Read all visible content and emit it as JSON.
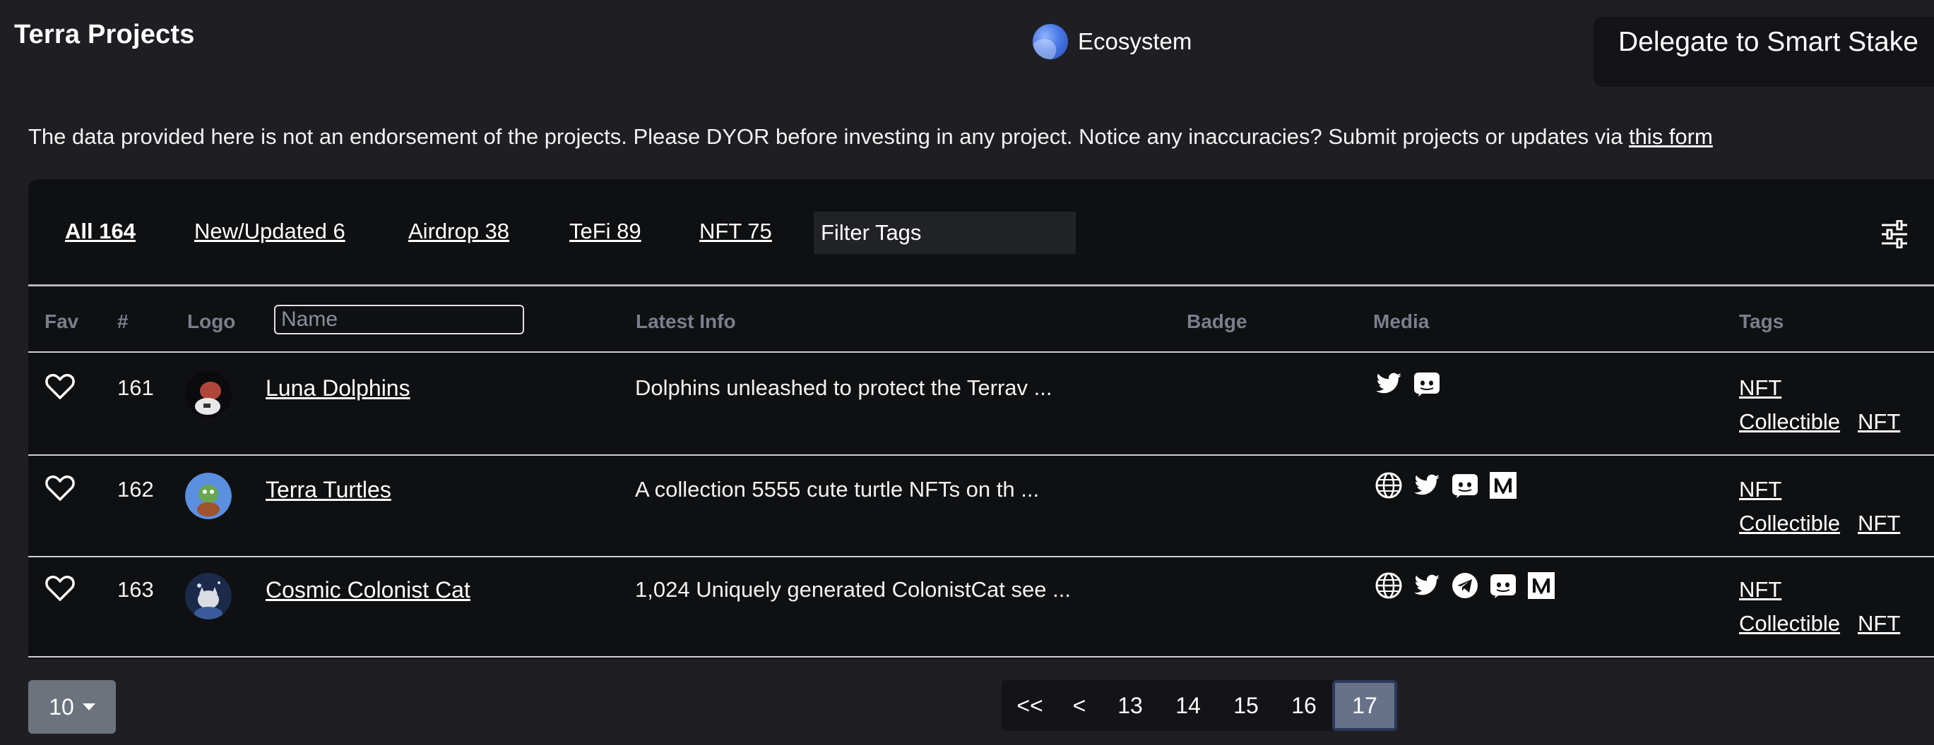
{
  "header": {
    "title": "Terra Projects",
    "ecosystem_label": "Ecosystem",
    "delegate_label": "Delegate to Smart Stake"
  },
  "notice": {
    "text": "The data provided here is not an endorsement of the projects. Please DYOR before investing in any project. Notice any inaccuracies? Submit projects or updates via ",
    "link_text": "this form"
  },
  "tabs": [
    {
      "label": "All 164",
      "active": true
    },
    {
      "label": "New/Updated 6",
      "active": false
    },
    {
      "label": "Airdrop 38",
      "active": false
    },
    {
      "label": "TeFi 89",
      "active": false
    },
    {
      "label": "NFT 75",
      "active": false
    }
  ],
  "filter": {
    "placeholder": "Filter Tags"
  },
  "table": {
    "headers": {
      "fav": "Fav",
      "number": "#",
      "logo": "Logo",
      "name_placeholder": "Name",
      "latest_info": "Latest Info",
      "badge": "Badge",
      "media": "Media",
      "tags": "Tags"
    },
    "rows": [
      {
        "number": "161",
        "name": "Luna Dolphins",
        "info": "Dolphins unleashed to protect the Terrav ...",
        "media": [
          "twitter-icon",
          "discord-icon"
        ],
        "tags": [
          "NFT",
          "Collectible",
          "NFT"
        ]
      },
      {
        "number": "162",
        "name": "Terra Turtles",
        "info": "A collection 5555 cute turtle NFTs on th ...",
        "media": [
          "website-icon",
          "twitter-icon",
          "discord-icon",
          "medium-icon"
        ],
        "tags": [
          "NFT",
          "Collectible",
          "NFT"
        ]
      },
      {
        "number": "163",
        "name": "Cosmic Colonist Cat",
        "info": "1,024 Uniquely generated ColonistCat see ...",
        "media": [
          "website-icon",
          "twitter-icon",
          "telegram-icon",
          "discord-icon",
          "medium-icon"
        ],
        "tags": [
          "NFT",
          "Collectible",
          "NFT"
        ]
      }
    ]
  },
  "pagination": {
    "page_size": "10",
    "first": "<<",
    "prev": "<",
    "pages": [
      "13",
      "14",
      "15",
      "16",
      "17"
    ],
    "current": "17"
  },
  "colors": {
    "background": "#1f1f23",
    "panel": "#0f1012",
    "header_text": "#7a7f8c",
    "active_page": "#67728a"
  }
}
